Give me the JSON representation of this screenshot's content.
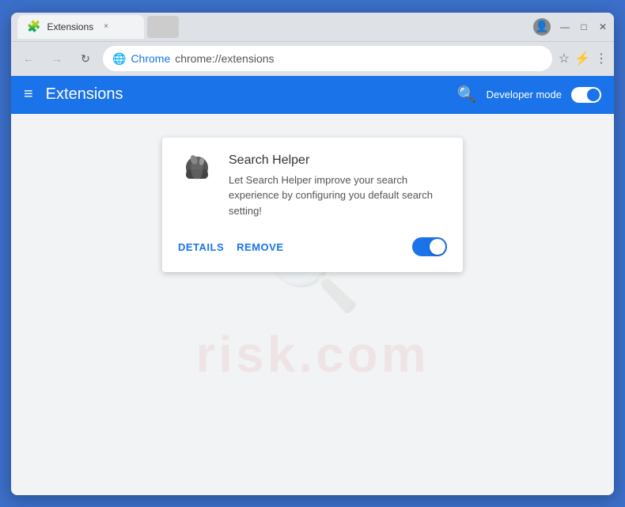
{
  "browser": {
    "tab": {
      "icon": "🧩",
      "label": "Extensions",
      "close": "×"
    },
    "window_controls": {
      "profile_icon": "👤",
      "minimize": "—",
      "restore": "□",
      "close": "✕"
    },
    "address_bar": {
      "back": "←",
      "forward": "→",
      "reload": "↻",
      "scheme_label": "Chrome",
      "url": "chrome://extensions",
      "bookmark": "☆",
      "more": "⋮"
    }
  },
  "extensions_page": {
    "header": {
      "menu_label": "≡",
      "title": "Extensions",
      "search_icon": "🔍",
      "dev_mode_label": "Developer mode"
    },
    "extension_card": {
      "name": "Search Helper",
      "description": "Let Search Helper improve your search experience by configuring you default search setting!",
      "details_btn": "DETAILS",
      "remove_btn": "REMOVE",
      "toggle_on": true
    }
  },
  "watermark": {
    "text": "risk.com"
  }
}
